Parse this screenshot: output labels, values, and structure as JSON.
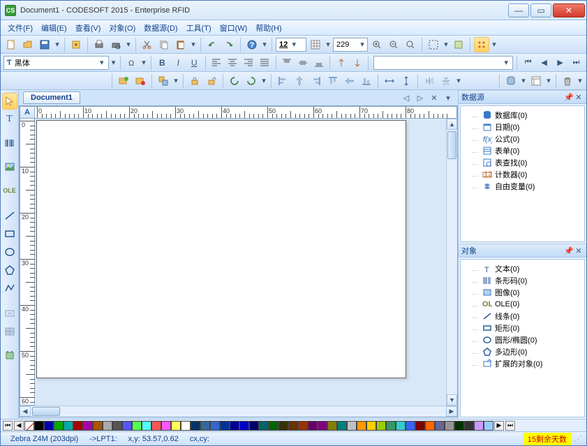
{
  "title": "Document1 - CODESOFT 2015 - Enterprise RFID",
  "appicon_text": "CS",
  "menu": [
    "文件(F)",
    "编辑(E)",
    "查看(V)",
    "对象(O)",
    "数据源(D)",
    "工具(T)",
    "窗口(W)",
    "帮助(H)"
  ],
  "zoom_value": "229",
  "font_name": "黑体",
  "font_size": "12",
  "doc_tab": "Document1",
  "corner_label": "A",
  "hruler_ticks": [
    0,
    10,
    20,
    30,
    40,
    50,
    60,
    70,
    80
  ],
  "vruler_ticks": [
    0,
    10,
    20,
    30,
    40,
    50,
    60
  ],
  "panel_ds_title": "数据源",
  "panel_obj_title": "对象",
  "ds_items": [
    {
      "icon": "db",
      "label": "数据库(0)",
      "color": "#3a7aca"
    },
    {
      "icon": "cal",
      "label": "日期(0)",
      "color": "#3a7aca"
    },
    {
      "icon": "fx",
      "label": "公式(0)",
      "color": "#2a6ab0"
    },
    {
      "icon": "form",
      "label": "表单(0)",
      "color": "#3a7aca"
    },
    {
      "icon": "look",
      "label": "表查找(0)",
      "color": "#3a7aca"
    },
    {
      "icon": "cnt",
      "label": "计数器(0)",
      "color": "#c06a2a"
    },
    {
      "icon": "free",
      "label": "自由变量(0)",
      "color": "#6a8ad0"
    }
  ],
  "obj_items": [
    {
      "icon": "T",
      "label": "文本(0)",
      "color": "#2a5aa0"
    },
    {
      "icon": "bc",
      "label": "条形码(0)",
      "color": "#2a5aa0"
    },
    {
      "icon": "img",
      "label": "图像(0)",
      "color": "#3a7aca"
    },
    {
      "icon": "ole",
      "label": "OLE(0)",
      "color": "#6a8a3a"
    },
    {
      "icon": "line",
      "label": "线条(0)",
      "color": "#2a5aa0"
    },
    {
      "icon": "rect",
      "label": "矩形(0)",
      "color": "#2a5aa0"
    },
    {
      "icon": "circ",
      "label": "圆形/椭圆(0)",
      "color": "#2a5aa0"
    },
    {
      "icon": "poly",
      "label": "多边形(0)",
      "color": "#2a5aa0"
    },
    {
      "icon": "ext",
      "label": "扩展的对象(0)",
      "color": "#3a7aca"
    }
  ],
  "palette_colors": [
    "#000000",
    "#0000AA",
    "#00AA00",
    "#00AAAA",
    "#AA0000",
    "#AA00AA",
    "#AA5500",
    "#AAAAAA",
    "#555555",
    "#5555FF",
    "#55FF55",
    "#55FFFF",
    "#FF5555",
    "#FF55FF",
    "#FFFF55",
    "#FFFFFF",
    "#003366",
    "#336699",
    "#3366CC",
    "#003399",
    "#000099",
    "#0000CC",
    "#000066",
    "#006666",
    "#006600",
    "#333300",
    "#663300",
    "#993300",
    "#660066",
    "#800080",
    "#808000",
    "#008080",
    "#C0C0C0",
    "#FF9900",
    "#FFCC00",
    "#99CC00",
    "#339966",
    "#33CCCC",
    "#3366FF",
    "#800000",
    "#FF6600",
    "#666699",
    "#969696",
    "#003300",
    "#333333",
    "#CC99FF",
    "#99CCFF"
  ],
  "status": {
    "printer": "Zebra Z4M (203dpi)",
    "port": "->LPT1:",
    "xy": "x,y: 53.57,0.62",
    "cxcy": "cx,cy:",
    "warn": "15剩余天数"
  }
}
